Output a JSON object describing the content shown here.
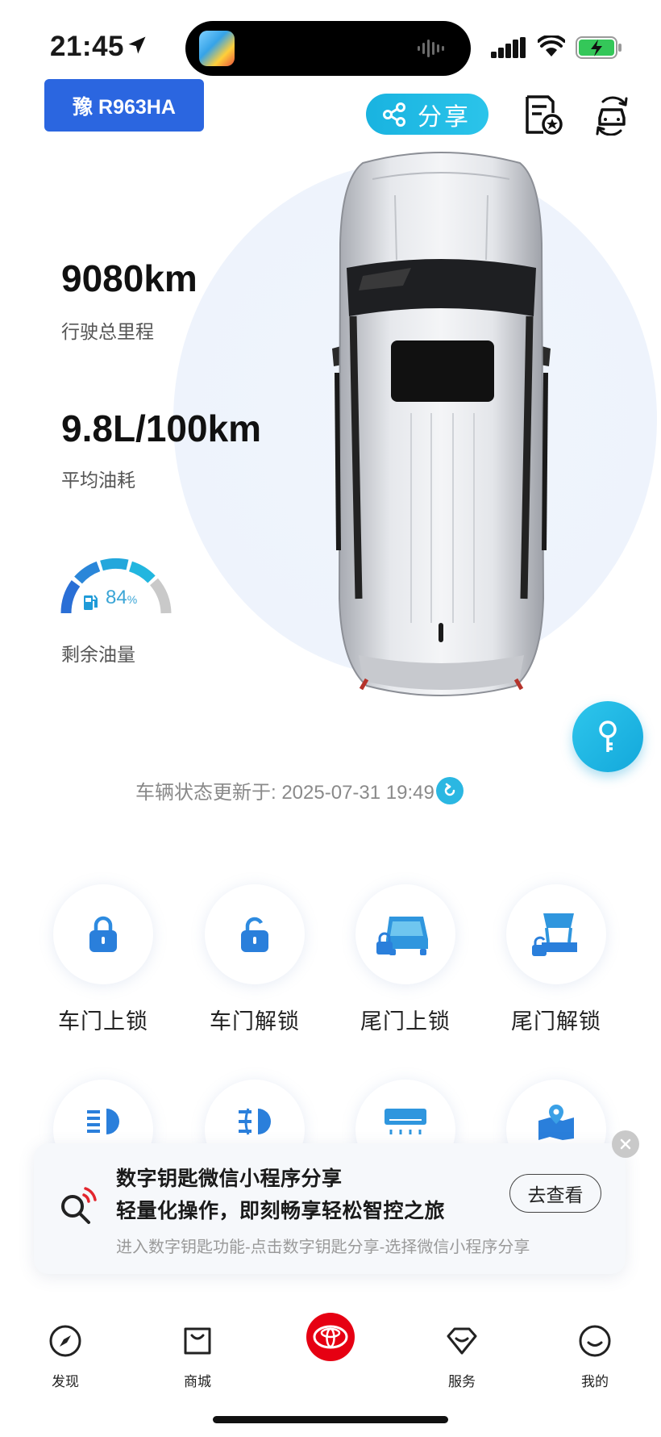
{
  "status_bar": {
    "time": "21:45"
  },
  "header": {
    "plate": "豫 R963HA",
    "share_label": "分享"
  },
  "stats": {
    "mileage_value": "9080km",
    "mileage_label": "行驶总里程",
    "fuel_consumption_value": "9.8L/100km",
    "fuel_consumption_label": "平均油耗",
    "fuel_level_value": "84",
    "fuel_level_unit": "%",
    "fuel_level_fraction": 0.84,
    "fuel_level_label": "剩余油量"
  },
  "update": {
    "text": "车辆状态更新于: 2025-07-31 19:49"
  },
  "controls": [
    {
      "label": "车门上锁",
      "icon": "lock-icon"
    },
    {
      "label": "车门解锁",
      "icon": "unlock-icon"
    },
    {
      "label": "尾门上锁",
      "icon": "tailgate-lock-icon"
    },
    {
      "label": "尾门解锁",
      "icon": "tailgate-unlock-icon"
    }
  ],
  "controls_row2_icons": [
    "headlight-icon",
    "fog-light-icon",
    "air-conditioner-icon",
    "map-location-icon"
  ],
  "banner": {
    "title": "数字钥匙微信小程序分享",
    "subtitle": "轻量化操作，即刻畅享轻松智控之旅",
    "description": "进入数字钥匙功能-点击数字钥匙分享-选择微信小程序分享",
    "button_label": "去查看"
  },
  "nav": {
    "items": [
      {
        "label": "发现",
        "icon": "compass-icon"
      },
      {
        "label": "商城",
        "icon": "shopping-bag-icon"
      },
      {
        "label": "",
        "icon": "toyota-logo-icon"
      },
      {
        "label": "服务",
        "icon": "diamond-icon"
      },
      {
        "label": "我的",
        "icon": "smile-icon"
      }
    ]
  },
  "colors": {
    "plate_blue": "#2b66e0",
    "accent_cyan": "#1fb5e3",
    "toyota_red": "#e60012"
  }
}
